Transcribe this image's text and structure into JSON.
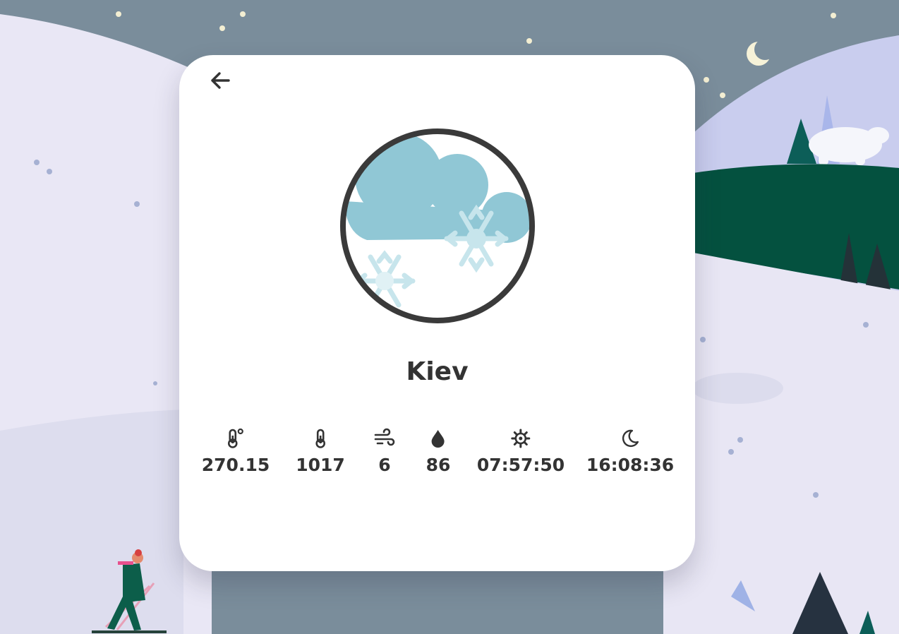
{
  "city": {
    "name": "Kiev"
  },
  "stats": [
    {
      "icon": "thermometer-degree-icon",
      "value": "270.15"
    },
    {
      "icon": "thermometer-icon",
      "value": "1017"
    },
    {
      "icon": "wind-icon",
      "value": "6"
    },
    {
      "icon": "humidity-drop-icon",
      "value": "86"
    },
    {
      "icon": "gear-icon",
      "value": "07:57:50"
    },
    {
      "icon": "moon-icon",
      "value": "16:08:36"
    }
  ],
  "weather": {
    "icon": "cloud-snow-icon"
  },
  "colors": {
    "sky": "#7a8d9b",
    "snow": "#e8e6f4",
    "forest": "#04513f",
    "cloud": "#90c7d5",
    "text": "#333333"
  }
}
